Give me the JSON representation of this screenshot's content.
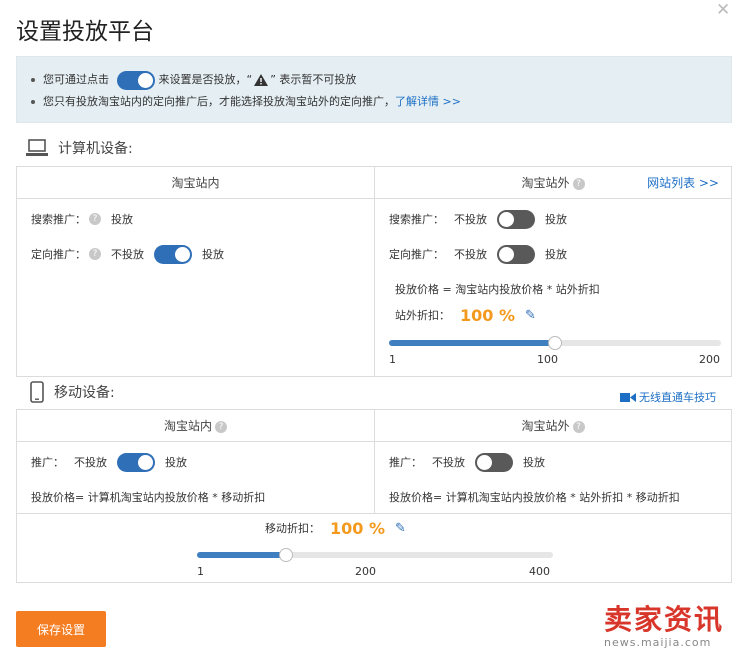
{
  "dialog": {
    "title": "设置投放平台",
    "close_symbol": "✕"
  },
  "notice": {
    "line1_prefix": "您可通过点击",
    "line1_suffix": "来设置是否投放，",
    "line1_quote_open": "“",
    "line1_quote_close": "”",
    "line1_warn": "表示暂不可投放",
    "line2_text": "您只有投放淘宝站内的定向推广后，才能选择投放淘宝站外的定向推广，",
    "line2_link": "了解详情 >>"
  },
  "pc": {
    "heading": "计算机设备:",
    "inside": {
      "header": "淘宝站内",
      "search_label": "搜索推广：",
      "search_value": "投放",
      "target_label": "定向推广：",
      "target_off": "不投放",
      "target_on": "投放"
    },
    "outside": {
      "header": "淘宝站外",
      "site_list_link": "网站列表 >>",
      "search_label": "搜索推广：",
      "search_off": "不投放",
      "search_on": "投放",
      "target_label": "定向推广：",
      "target_off": "不投放",
      "target_on": "投放",
      "formula": "投放价格 = 淘宝站内投放价格 * 站外折扣",
      "discount_label": "站外折扣：",
      "discount_value": "100 %",
      "slider_min": "1",
      "slider_mid": "100",
      "slider_max": "200",
      "slider_fraction": 0.5
    }
  },
  "mobile": {
    "heading": "移动设备:",
    "video_link": "无线直通车技巧",
    "inside": {
      "header": "淘宝站内",
      "promo_label": "推广：",
      "promo_off": "不投放",
      "promo_on": "投放",
      "formula": "投放价格= 计算机淘宝站内投放价格 * 移动折扣"
    },
    "outside": {
      "header": "淘宝站外",
      "promo_label": "推广：",
      "promo_off": "不投放",
      "promo_on": "投放",
      "formula": "投放价格= 计算机淘宝站内投放价格 * 站外折扣 * 移动折扣"
    },
    "discount_label": "移动折扣：",
    "discount_value": "100 %",
    "slider_min": "1",
    "slider_mid": "200",
    "slider_max": "400",
    "slider_fraction": 0.25
  },
  "save_button": "保存设置",
  "watermark": {
    "brand": "卖家资讯",
    "url": "news.maijia.com"
  },
  "colors": {
    "accent": "#2f6fb7",
    "price": "#f39a1e",
    "save": "#f47d22",
    "toggle_off": "#595959"
  }
}
